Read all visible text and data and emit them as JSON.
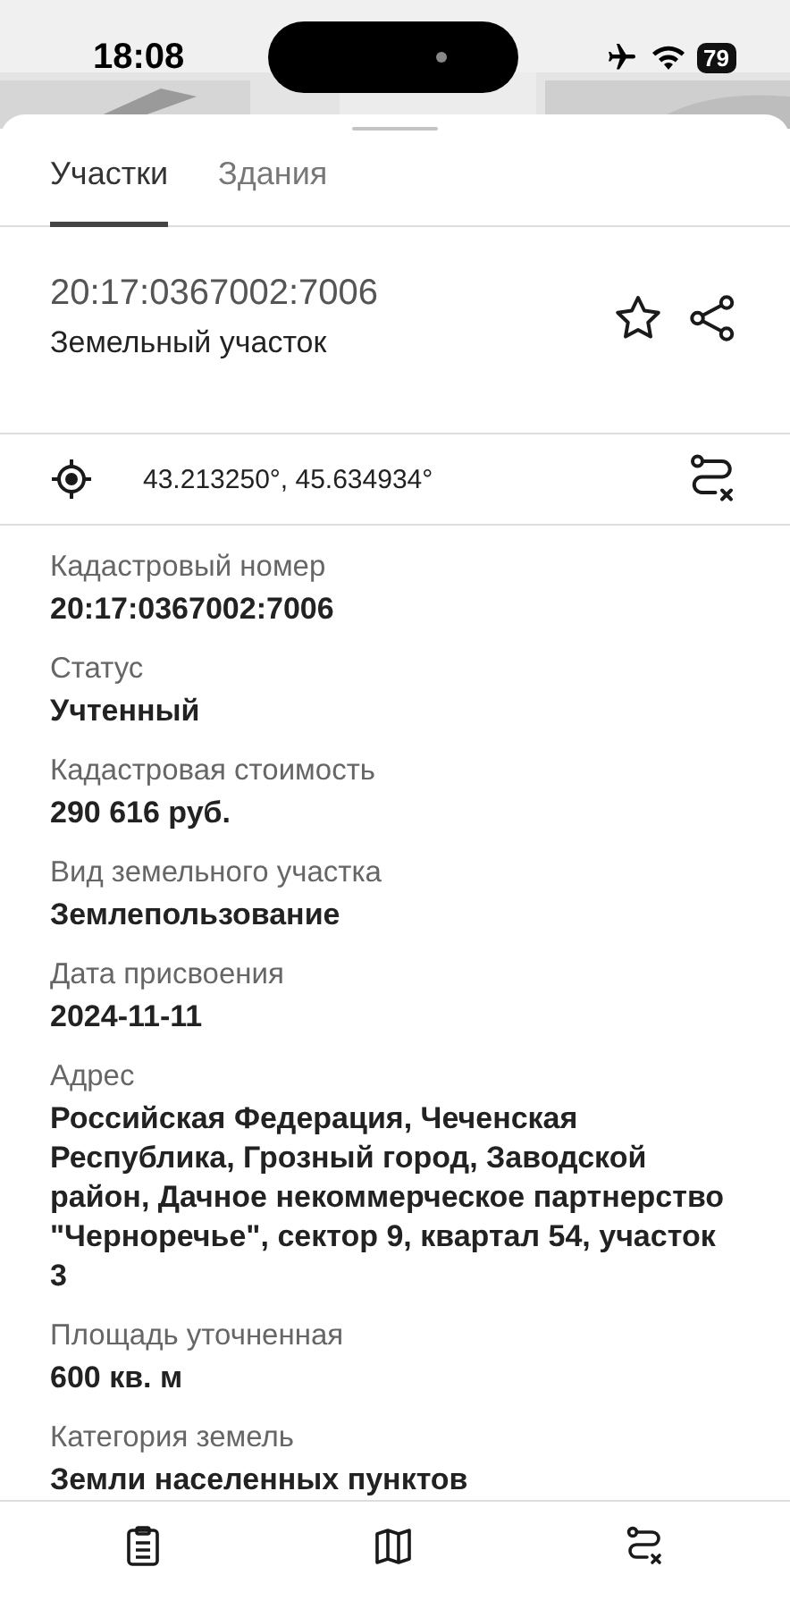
{
  "status_bar": {
    "time": "18:08",
    "battery": "79"
  },
  "tabs": [
    {
      "label": "Участки",
      "selected": true
    },
    {
      "label": "Здания",
      "selected": false
    }
  ],
  "header": {
    "title": "20:17:0367002:7006",
    "subtitle": "Земельный участок"
  },
  "coordinates": "43.213250°, 45.634934°",
  "fields": [
    {
      "label": "Кадастровый номер",
      "value": "20:17:0367002:7006"
    },
    {
      "label": "Статус",
      "value": "Учтенный"
    },
    {
      "label": "Кадастровая стоимость",
      "value": "290 616 руб."
    },
    {
      "label": "Вид земельного участка",
      "value": "Землепользование"
    },
    {
      "label": "Дата присвоения",
      "value": "2024-11-11"
    },
    {
      "label": "Адрес",
      "value": "Российская Федерация, Чеченская Республика, Грозный город, Заводской район, Дачное некоммерческое партнерство \"Черноречье\", сектор 9, квартал 54, участок 3"
    },
    {
      "label": "Площадь уточненная",
      "value": "600 кв. м"
    },
    {
      "label": "Категория земель",
      "value": "Земли населенных пунктов"
    }
  ],
  "bottom_nav": [
    {
      "kind": "clipboard"
    },
    {
      "kind": "map"
    },
    {
      "kind": "route"
    }
  ]
}
